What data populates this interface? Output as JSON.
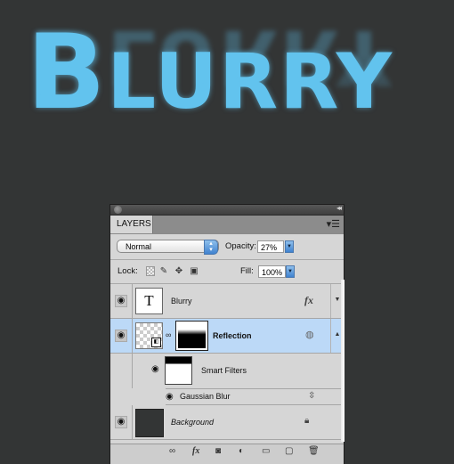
{
  "artwork": {
    "first_letter": "B",
    "rest_letters": "LURRY",
    "color": "#62c3ee",
    "background": "#333535"
  },
  "panel": {
    "tab_label": "LAYERS",
    "menu_icon": "panel-menu-icon",
    "collapse_icon": "collapse-double-arrow-icon",
    "blend_mode": "Normal",
    "opacity_label": "Opacity:",
    "opacity_value": "27%",
    "lock_label": "Lock:",
    "fill_label": "Fill:",
    "fill_value": "100%",
    "lock_icons": [
      "lock-transparent-icon",
      "lock-paint-icon",
      "lock-move-icon",
      "lock-all-icon"
    ],
    "layers": [
      {
        "name": "Blurry",
        "type": "text",
        "thumb_glyph": "T",
        "visible": true,
        "badge": "fx",
        "selected": false
      },
      {
        "name": "Reflection",
        "type": "smart-object",
        "visible": true,
        "badge": "smart-filter-indicator",
        "selected": true
      },
      {
        "name": "Smart Filters",
        "type": "smart-filters",
        "visible": true,
        "selected": false
      },
      {
        "name": "Gaussian Blur",
        "type": "filter",
        "visible": true,
        "badge": "filter-blending-options",
        "selected": false
      },
      {
        "name": "Background",
        "type": "background",
        "visible": true,
        "badge": "lock",
        "selected": false
      }
    ],
    "bottom_icons": [
      "link-layers-icon",
      "fx-icon",
      "add-mask-icon",
      "adjustment-layer-icon",
      "new-group-icon",
      "new-layer-icon",
      "trash-icon"
    ]
  }
}
